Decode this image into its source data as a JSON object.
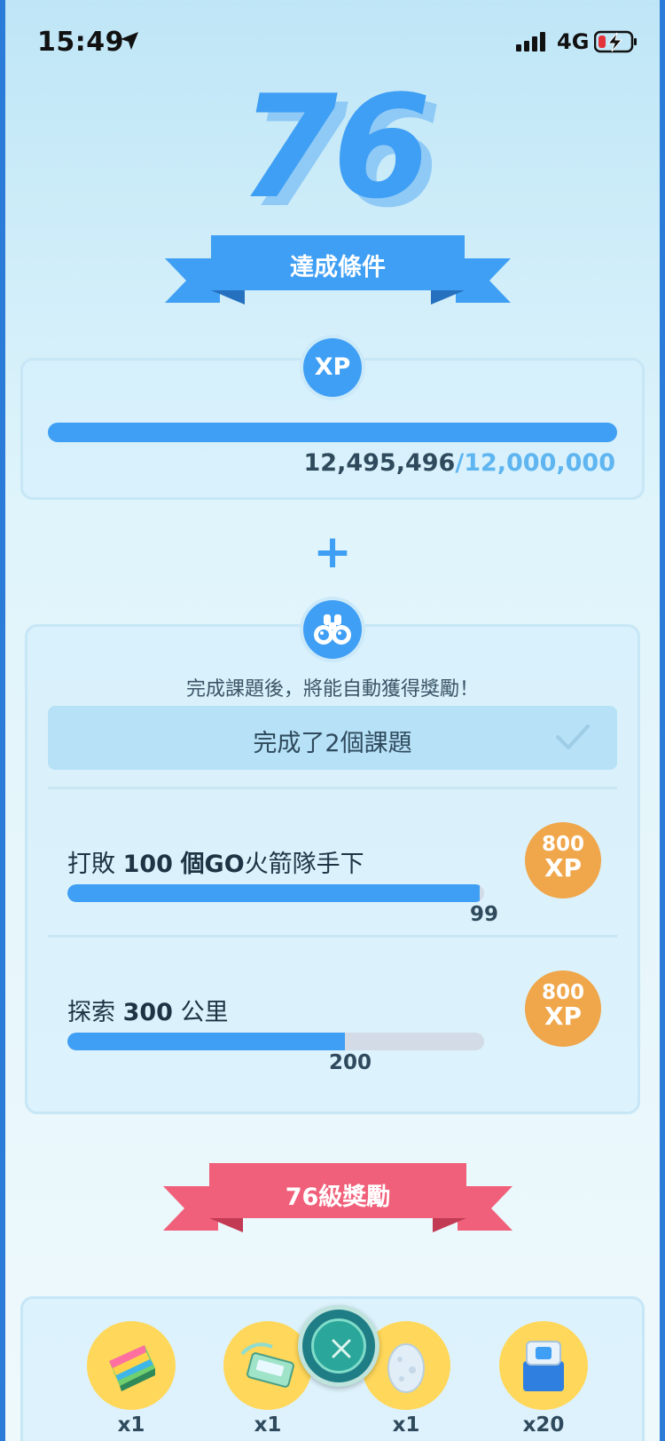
{
  "status_bar": {
    "time": "15:49",
    "network": "4G"
  },
  "level": "76",
  "requirements_ribbon": "達成條件",
  "xp": {
    "badge": "XP",
    "current": "12,495,496",
    "separator": "/",
    "required": "12,000,000",
    "progress": 1.0
  },
  "plus_sign": "+",
  "tasks_section": {
    "hint": "完成課題後，將能自動獲得獎勵！",
    "completed_label": "完成了2個課題",
    "tasks": [
      {
        "prefix": "打敗",
        "number": "100",
        "suffix_bold": "個GO",
        "suffix": "火箭隊手下",
        "count": "99",
        "progress": 0.99,
        "reward_amount": "800",
        "reward_unit": "XP"
      },
      {
        "prefix": "探索",
        "number": "300",
        "suffix_bold": "",
        "suffix": "公里",
        "count": "200",
        "progress": 0.667,
        "reward_amount": "800",
        "reward_unit": "XP"
      }
    ]
  },
  "rewards_ribbon": {
    "level": "76",
    "label": "級獎勵"
  },
  "rewards": [
    {
      "icon": "rainbow-candy-icon",
      "qty": "x1"
    },
    {
      "icon": "elite-tm-icon",
      "qty": "x1"
    },
    {
      "icon": "egg-icon",
      "qty": "x1"
    },
    {
      "icon": "item-box-icon",
      "qty": "x20"
    }
  ],
  "colors": {
    "accent": "#3f9ff4",
    "reward_ribbon": "#f0607a",
    "coin": "#f0a64a",
    "reward_circle": "#ffd75a"
  }
}
